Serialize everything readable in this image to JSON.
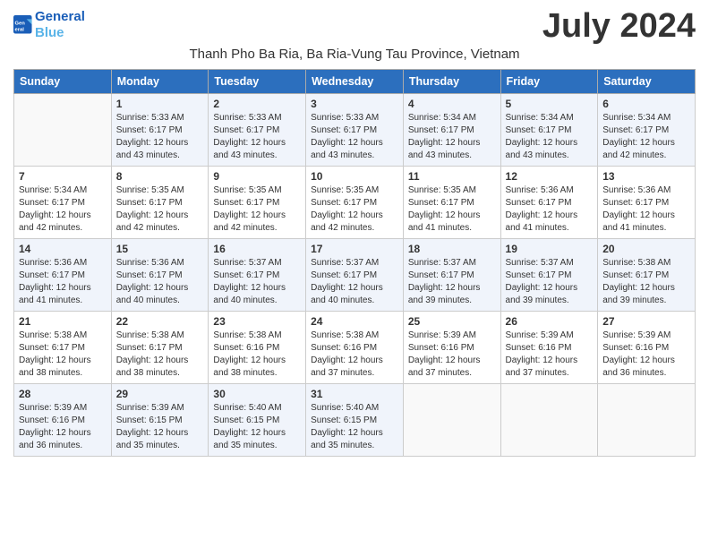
{
  "header": {
    "logo_line1": "General",
    "logo_line2": "Blue",
    "month": "July 2024",
    "location": "Thanh Pho Ba Ria, Ba Ria-Vung Tau Province, Vietnam"
  },
  "days_of_week": [
    "Sunday",
    "Monday",
    "Tuesday",
    "Wednesday",
    "Thursday",
    "Friday",
    "Saturday"
  ],
  "weeks": [
    [
      {
        "day": "",
        "sunrise": "",
        "sunset": "",
        "daylight": ""
      },
      {
        "day": "1",
        "sunrise": "Sunrise: 5:33 AM",
        "sunset": "Sunset: 6:17 PM",
        "daylight": "Daylight: 12 hours and 43 minutes."
      },
      {
        "day": "2",
        "sunrise": "Sunrise: 5:33 AM",
        "sunset": "Sunset: 6:17 PM",
        "daylight": "Daylight: 12 hours and 43 minutes."
      },
      {
        "day": "3",
        "sunrise": "Sunrise: 5:33 AM",
        "sunset": "Sunset: 6:17 PM",
        "daylight": "Daylight: 12 hours and 43 minutes."
      },
      {
        "day": "4",
        "sunrise": "Sunrise: 5:34 AM",
        "sunset": "Sunset: 6:17 PM",
        "daylight": "Daylight: 12 hours and 43 minutes."
      },
      {
        "day": "5",
        "sunrise": "Sunrise: 5:34 AM",
        "sunset": "Sunset: 6:17 PM",
        "daylight": "Daylight: 12 hours and 43 minutes."
      },
      {
        "day": "6",
        "sunrise": "Sunrise: 5:34 AM",
        "sunset": "Sunset: 6:17 PM",
        "daylight": "Daylight: 12 hours and 42 minutes."
      }
    ],
    [
      {
        "day": "7",
        "sunrise": "Sunrise: 5:34 AM",
        "sunset": "Sunset: 6:17 PM",
        "daylight": "Daylight: 12 hours and 42 minutes."
      },
      {
        "day": "8",
        "sunrise": "Sunrise: 5:35 AM",
        "sunset": "Sunset: 6:17 PM",
        "daylight": "Daylight: 12 hours and 42 minutes."
      },
      {
        "day": "9",
        "sunrise": "Sunrise: 5:35 AM",
        "sunset": "Sunset: 6:17 PM",
        "daylight": "Daylight: 12 hours and 42 minutes."
      },
      {
        "day": "10",
        "sunrise": "Sunrise: 5:35 AM",
        "sunset": "Sunset: 6:17 PM",
        "daylight": "Daylight: 12 hours and 42 minutes."
      },
      {
        "day": "11",
        "sunrise": "Sunrise: 5:35 AM",
        "sunset": "Sunset: 6:17 PM",
        "daylight": "Daylight: 12 hours and 41 minutes."
      },
      {
        "day": "12",
        "sunrise": "Sunrise: 5:36 AM",
        "sunset": "Sunset: 6:17 PM",
        "daylight": "Daylight: 12 hours and 41 minutes."
      },
      {
        "day": "13",
        "sunrise": "Sunrise: 5:36 AM",
        "sunset": "Sunset: 6:17 PM",
        "daylight": "Daylight: 12 hours and 41 minutes."
      }
    ],
    [
      {
        "day": "14",
        "sunrise": "Sunrise: 5:36 AM",
        "sunset": "Sunset: 6:17 PM",
        "daylight": "Daylight: 12 hours and 41 minutes."
      },
      {
        "day": "15",
        "sunrise": "Sunrise: 5:36 AM",
        "sunset": "Sunset: 6:17 PM",
        "daylight": "Daylight: 12 hours and 40 minutes."
      },
      {
        "day": "16",
        "sunrise": "Sunrise: 5:37 AM",
        "sunset": "Sunset: 6:17 PM",
        "daylight": "Daylight: 12 hours and 40 minutes."
      },
      {
        "day": "17",
        "sunrise": "Sunrise: 5:37 AM",
        "sunset": "Sunset: 6:17 PM",
        "daylight": "Daylight: 12 hours and 40 minutes."
      },
      {
        "day": "18",
        "sunrise": "Sunrise: 5:37 AM",
        "sunset": "Sunset: 6:17 PM",
        "daylight": "Daylight: 12 hours and 39 minutes."
      },
      {
        "day": "19",
        "sunrise": "Sunrise: 5:37 AM",
        "sunset": "Sunset: 6:17 PM",
        "daylight": "Daylight: 12 hours and 39 minutes."
      },
      {
        "day": "20",
        "sunrise": "Sunrise: 5:38 AM",
        "sunset": "Sunset: 6:17 PM",
        "daylight": "Daylight: 12 hours and 39 minutes."
      }
    ],
    [
      {
        "day": "21",
        "sunrise": "Sunrise: 5:38 AM",
        "sunset": "Sunset: 6:17 PM",
        "daylight": "Daylight: 12 hours and 38 minutes."
      },
      {
        "day": "22",
        "sunrise": "Sunrise: 5:38 AM",
        "sunset": "Sunset: 6:17 PM",
        "daylight": "Daylight: 12 hours and 38 minutes."
      },
      {
        "day": "23",
        "sunrise": "Sunrise: 5:38 AM",
        "sunset": "Sunset: 6:16 PM",
        "daylight": "Daylight: 12 hours and 38 minutes."
      },
      {
        "day": "24",
        "sunrise": "Sunrise: 5:38 AM",
        "sunset": "Sunset: 6:16 PM",
        "daylight": "Daylight: 12 hours and 37 minutes."
      },
      {
        "day": "25",
        "sunrise": "Sunrise: 5:39 AM",
        "sunset": "Sunset: 6:16 PM",
        "daylight": "Daylight: 12 hours and 37 minutes."
      },
      {
        "day": "26",
        "sunrise": "Sunrise: 5:39 AM",
        "sunset": "Sunset: 6:16 PM",
        "daylight": "Daylight: 12 hours and 37 minutes."
      },
      {
        "day": "27",
        "sunrise": "Sunrise: 5:39 AM",
        "sunset": "Sunset: 6:16 PM",
        "daylight": "Daylight: 12 hours and 36 minutes."
      }
    ],
    [
      {
        "day": "28",
        "sunrise": "Sunrise: 5:39 AM",
        "sunset": "Sunset: 6:16 PM",
        "daylight": "Daylight: 12 hours and 36 minutes."
      },
      {
        "day": "29",
        "sunrise": "Sunrise: 5:39 AM",
        "sunset": "Sunset: 6:15 PM",
        "daylight": "Daylight: 12 hours and 35 minutes."
      },
      {
        "day": "30",
        "sunrise": "Sunrise: 5:40 AM",
        "sunset": "Sunset: 6:15 PM",
        "daylight": "Daylight: 12 hours and 35 minutes."
      },
      {
        "day": "31",
        "sunrise": "Sunrise: 5:40 AM",
        "sunset": "Sunset: 6:15 PM",
        "daylight": "Daylight: 12 hours and 35 minutes."
      },
      {
        "day": "",
        "sunrise": "",
        "sunset": "",
        "daylight": ""
      },
      {
        "day": "",
        "sunrise": "",
        "sunset": "",
        "daylight": ""
      },
      {
        "day": "",
        "sunrise": "",
        "sunset": "",
        "daylight": ""
      }
    ]
  ]
}
